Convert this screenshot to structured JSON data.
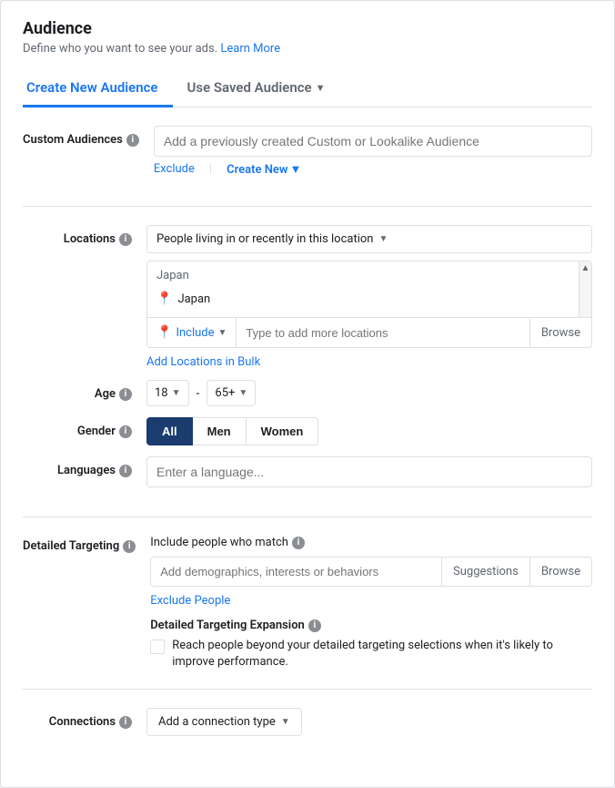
{
  "page": {
    "title": "Audience",
    "subtitle": "Define who you want to see your ads.",
    "learn_more": "Learn More"
  },
  "tabs": {
    "create_new": "Create New Audience",
    "use_saved": "Use Saved Audience"
  },
  "custom_audiences": {
    "label": "Custom Audiences",
    "placeholder": "Add a previously created Custom or Lookalike Audience",
    "exclude_label": "Exclude",
    "create_new_label": "Create New"
  },
  "locations": {
    "label": "Locations",
    "dropdown_label": "People living in or recently in this location",
    "search_placeholder": "Japan",
    "location_item": "Japan",
    "include_label": "Include",
    "type_placeholder": "Type to add more locations",
    "browse_label": "Browse",
    "bulk_label": "Add Locations in Bulk"
  },
  "age": {
    "label": "Age",
    "from": "18",
    "to": "65+"
  },
  "gender": {
    "label": "Gender",
    "options": [
      "All",
      "Men",
      "Women"
    ],
    "active": "All"
  },
  "languages": {
    "label": "Languages",
    "placeholder": "Enter a language..."
  },
  "detailed_targeting": {
    "label": "Detailed Targeting",
    "title": "Include people who match",
    "placeholder": "Add demographics, interests or behaviors",
    "suggestions_label": "Suggestions",
    "browse_label": "Browse",
    "exclude_label": "Exclude People",
    "expansion_title": "Detailed Targeting Expansion",
    "expansion_text": "Reach people beyond your detailed targeting selections when it's likely to improve performance."
  },
  "connections": {
    "label": "Connections",
    "dropdown_label": "Add a connection type"
  }
}
